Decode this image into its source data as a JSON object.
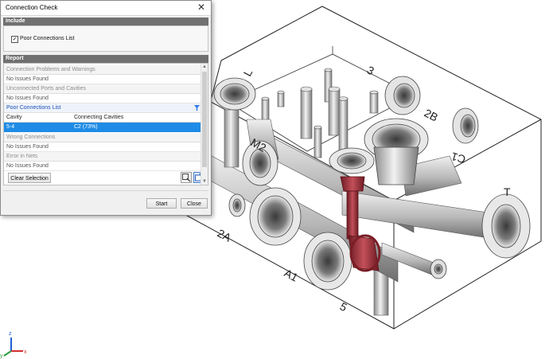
{
  "dialog": {
    "title": "Connection Check",
    "close_glyph": "✕",
    "include_header": "Include",
    "include_option": {
      "label": "Poor Connections List",
      "checked": true
    },
    "report_header": "Report",
    "groups": [
      {
        "label": "Connection Problems and Warnings",
        "status": "No Issues Found"
      },
      {
        "label": "Unconnected Ports and Cavities",
        "status": "No Issues Found"
      },
      {
        "label": "Poor Connections List"
      },
      {
        "label": "Wrong Connections",
        "status": "No Issues Found"
      },
      {
        "label": "Error in Nets",
        "status": "No Issues Found"
      }
    ],
    "table": {
      "columns": [
        "Cavity",
        "Connecting Cavities"
      ],
      "rows": [
        [
          "5-4",
          "C2 (73%)"
        ]
      ]
    },
    "clear_selection_label": "Clear Selection",
    "zoom_button_icon": "zoom-to-icon",
    "export_button_icon": "export-icon",
    "start_label": "Start",
    "close_label": "Close"
  },
  "model_labels": {
    "top_edge": "3",
    "port_L": "L",
    "port_2B": "2B",
    "port_C1": "C1",
    "port_M2": "M2",
    "port_T": "T",
    "port_2A": "2A",
    "port_A1": "A1",
    "port_5": "5"
  },
  "axis_triad": {
    "x": "x",
    "y": "y",
    "z": "z"
  },
  "colors": {
    "block_edge": "#222222",
    "highlight_connection": "#a8353f",
    "selection": "#1e8ce6",
    "section_header": "#707070",
    "axis_x": "#d32f2f",
    "axis_y": "#2e9e3c",
    "axis_z": "#1f5fd6"
  }
}
